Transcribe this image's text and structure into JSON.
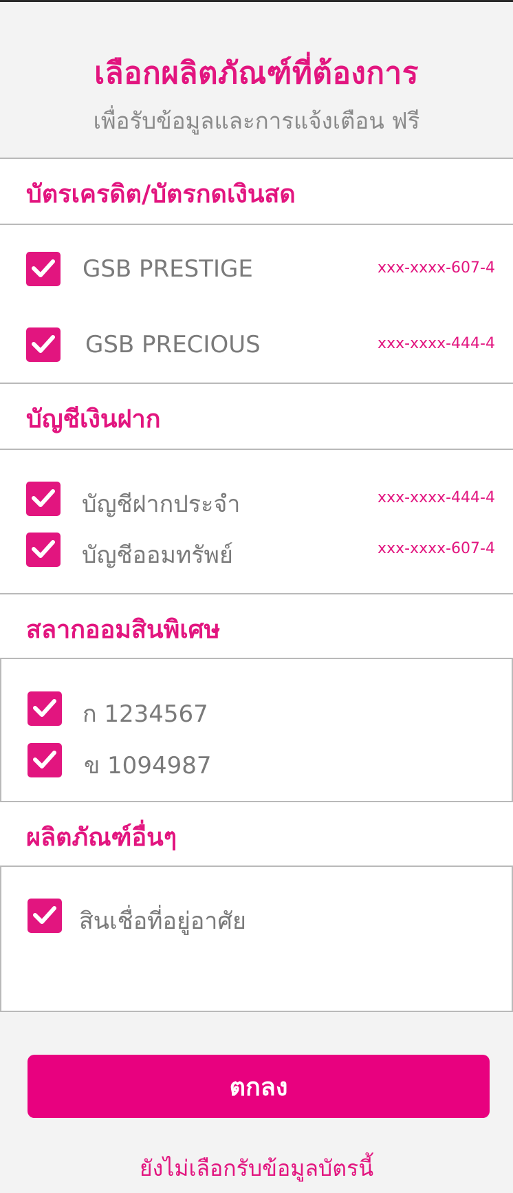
{
  "header": {
    "title": "เลือกผลิตภัณฑ์ที่ต้องการ",
    "subtitle": "เพื่อรับข้อมูลและการแจ้งเตือน ฟรี"
  },
  "sections": [
    {
      "title": "บัตรเครดิต/บัตรกดเงินสด",
      "items": [
        {
          "name": "GSB PRESTIGE",
          "account": "xxx-xxxx-607-4",
          "checked": true
        },
        {
          "name": "GSB PRECIOUS",
          "account": "xxx-xxxx-444-4",
          "checked": true
        }
      ]
    },
    {
      "title": "บัญชีเงินฝาก",
      "items": [
        {
          "name": "บัญชีฝากประจำ",
          "account": "xxx-xxxx-444-4",
          "checked": true
        },
        {
          "name": "บัญชีออมทรัพย์",
          "account": "xxx-xxxx-607-4",
          "checked": true
        }
      ]
    },
    {
      "title": "สลากออมสินพิเศษ",
      "items": [
        {
          "name": "ก 1234567",
          "checked": true
        },
        {
          "name": "ข 1094987",
          "checked": true
        }
      ]
    },
    {
      "title": "ผลิตภัณฑ์อื่นๆ",
      "items": [
        {
          "name": "สินเชื่อที่อยู่อาศัย",
          "checked": true
        }
      ]
    }
  ],
  "actions": {
    "confirm_label": "ตกลง",
    "skip_label": "ยังไม่เลือกรับข้อมูลบัตรนี้"
  },
  "colors": {
    "accent": "#e2157f",
    "button": "#e8017f",
    "background": "#f3f3f3"
  }
}
